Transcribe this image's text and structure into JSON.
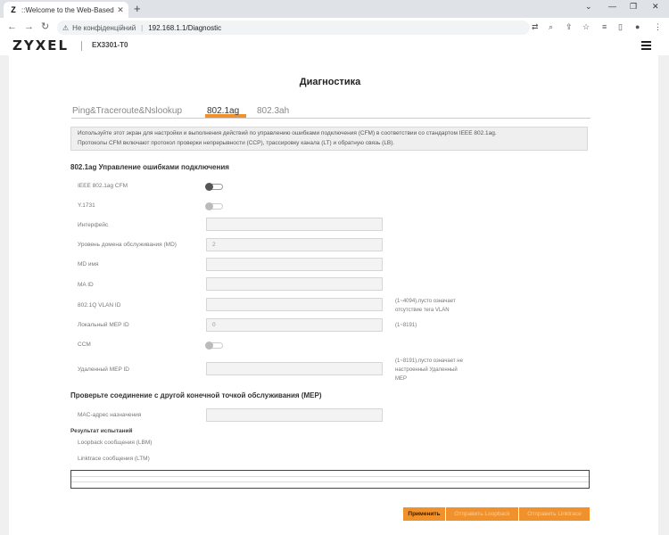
{
  "browser": {
    "tab_title": "::Welcome to the Web-Based Co",
    "tab_favicon": "Z",
    "security_text": "Не конфіденційний",
    "url": "192.168.1.1/Diagnostic"
  },
  "header": {
    "logo": "ZYXEL",
    "model": "EX3301-T0"
  },
  "page": {
    "title": "Диагностика",
    "tabs": [
      {
        "label": "Ping&Traceroute&Nslookup"
      },
      {
        "label": "802.1ag"
      },
      {
        "label": "802.3ah"
      }
    ],
    "info_line1": "Используйте этот экран для настройки и выполнения действий по управлению ошибками подключения (CFM) в соответствии со стандартом IEEE 802.1ag.",
    "info_line2": "Протоколы CFM включают протокол проверки непрерывности (CCP), трассировку канала (LT) и обратную связь (LB)."
  },
  "section1": {
    "title": "802.1ag Управление ошибками подключения",
    "cfm_label": "IEEE 802.1ag CFM",
    "y1731_label": "Y.1731",
    "interface_label": "Интерфейс",
    "md_level_label": "Уровень домена обслуживания (MD)",
    "md_level_value": "2",
    "md_name_label": "MD имя",
    "ma_id_label": "MA ID",
    "vlan_label": "802.1Q VLAN ID",
    "vlan_hint_1": "(1~4094),пусто означает",
    "vlan_hint_2": "отсутствие тега VLAN",
    "local_mep_label": "Локальный MEP ID",
    "local_mep_value": "0",
    "local_mep_hint": "(1~8191)",
    "ccm_label": "CCM",
    "remote_mep_label": "Удаленный MEP ID",
    "remote_hint_1": "(1~8191),пусто означает не",
    "remote_hint_2": "настроенный Удаленный",
    "remote_hint_3": "MEP"
  },
  "section2": {
    "title": "Проверьте соединение с другой конечной точкой обслуживания (MEP)",
    "mac_label": "MAC-адрес назначения",
    "results_title": "Результат испытаний",
    "lbm_label": "Loopback сообщения (LBM)",
    "ltm_label": "Linktrace сообщения (LTM)"
  },
  "buttons": {
    "apply": "Применить",
    "send_loopback": "Отправить Loopback",
    "send_linktrace": "Отправить Linktrace"
  },
  "colors": {
    "accent": "#f0912c"
  }
}
